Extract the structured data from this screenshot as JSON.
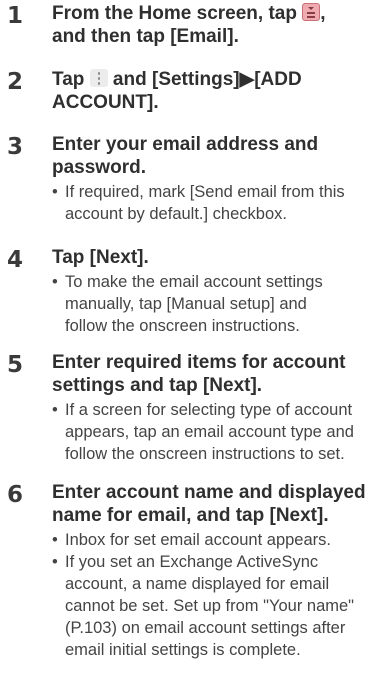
{
  "steps": [
    {
      "number": "1",
      "title_parts": [
        "From the Home screen, tap ",
        ",",
        "and then tap [Email]."
      ],
      "icons": [
        "apps-list-icon"
      ]
    },
    {
      "number": "2",
      "title_parts": [
        "Tap ",
        " and [Settings]▶[ADD",
        "ACCOUNT]."
      ],
      "icons": [
        "menu-dots-icon"
      ]
    },
    {
      "number": "3",
      "title_lines": [
        "Enter your email address and",
        "password."
      ],
      "bullets": [
        [
          "If required, mark [Send email from this",
          "account by default.] checkbox."
        ]
      ]
    },
    {
      "number": "4",
      "title_lines": [
        "Tap [Next]."
      ],
      "bullets": [
        [
          "To make the email account settings",
          "manually, tap [Manual setup] and",
          "follow the onscreen instructions."
        ]
      ]
    },
    {
      "number": "5",
      "title_lines": [
        "Enter required items for account",
        "settings and tap [Next]."
      ],
      "bullets": [
        [
          "If a screen for selecting type of account",
          "appears, tap an email account type and",
          "follow the onscreen instructions to set."
        ]
      ]
    },
    {
      "number": "6",
      "title_lines": [
        "Enter account name and displayed",
        "name for email, and tap [Next]."
      ],
      "bullets": [
        [
          "Inbox for set email account appears."
        ],
        [
          "If you set an Exchange ActiveSync",
          "account, a name displayed for email",
          "cannot be set. Set up from \"Your name\"",
          "(P.103) on email account settings after",
          "email initial settings is complete."
        ]
      ]
    }
  ]
}
